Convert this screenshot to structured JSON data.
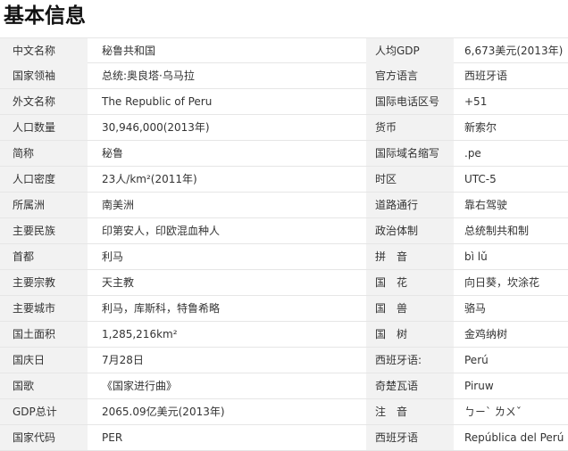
{
  "title": "基本信息",
  "rows": [
    {
      "k1": "中文名称",
      "v1": "秘鲁共和国",
      "k2": "人均GDP",
      "v2": "6,673美元(2013年)"
    },
    {
      "k1": "国家领袖",
      "v1": "总统:奥良塔·乌马拉",
      "k2": "官方语言",
      "v2": "西班牙语"
    },
    {
      "k1": "外文名称",
      "v1": "The Republic of Peru",
      "k2": "国际电话区号",
      "v2": "+51"
    },
    {
      "k1": "人口数量",
      "v1": "30,946,000(2013年)",
      "k2": "货币",
      "v2": "新索尔"
    },
    {
      "k1": "简称",
      "v1": "秘鲁",
      "k2": "国际域名缩写",
      "v2": ".pe"
    },
    {
      "k1": "人口密度",
      "v1": "23人/km²(2011年)",
      "k2": "时区",
      "v2": "UTC-5"
    },
    {
      "k1": "所属洲",
      "v1": "南美洲",
      "k2": "道路通行",
      "v2": "靠右驾驶"
    },
    {
      "k1": "主要民族",
      "v1": "印第安人，印欧混血种人",
      "k2": "政治体制",
      "v2": "总统制共和制"
    },
    {
      "k1": "首都",
      "v1": "利马",
      "k2": "拼　音",
      "v2": "bì lǔ"
    },
    {
      "k1": "主要宗教",
      "v1": "天主教",
      "k2": "国　花",
      "v2": "向日葵，坎涂花"
    },
    {
      "k1": "主要城市",
      "v1": "利马，库斯科，特鲁希略",
      "k2": "国　兽",
      "v2": "骆马"
    },
    {
      "k1": "国土面积",
      "v1": "1,285,216km²",
      "k2": "国　树",
      "v2": "金鸡纳树"
    },
    {
      "k1": "国庆日",
      "v1": "7月28日",
      "k2": "西班牙语:",
      "v2": "Perú"
    },
    {
      "k1": "国歌",
      "v1": "《国家进行曲》",
      "k2": "奇楚瓦语",
      "v2": "Piruw"
    },
    {
      "k1": "GDP总计",
      "v1": "2065.09亿美元(2013年)",
      "k2": "注　音",
      "v2": "ㄅㄧˋ ㄌㄨˇ"
    },
    {
      "k1": "国家代码",
      "v1": "PER",
      "k2": "西班牙语",
      "v2": "República del Perú"
    }
  ]
}
